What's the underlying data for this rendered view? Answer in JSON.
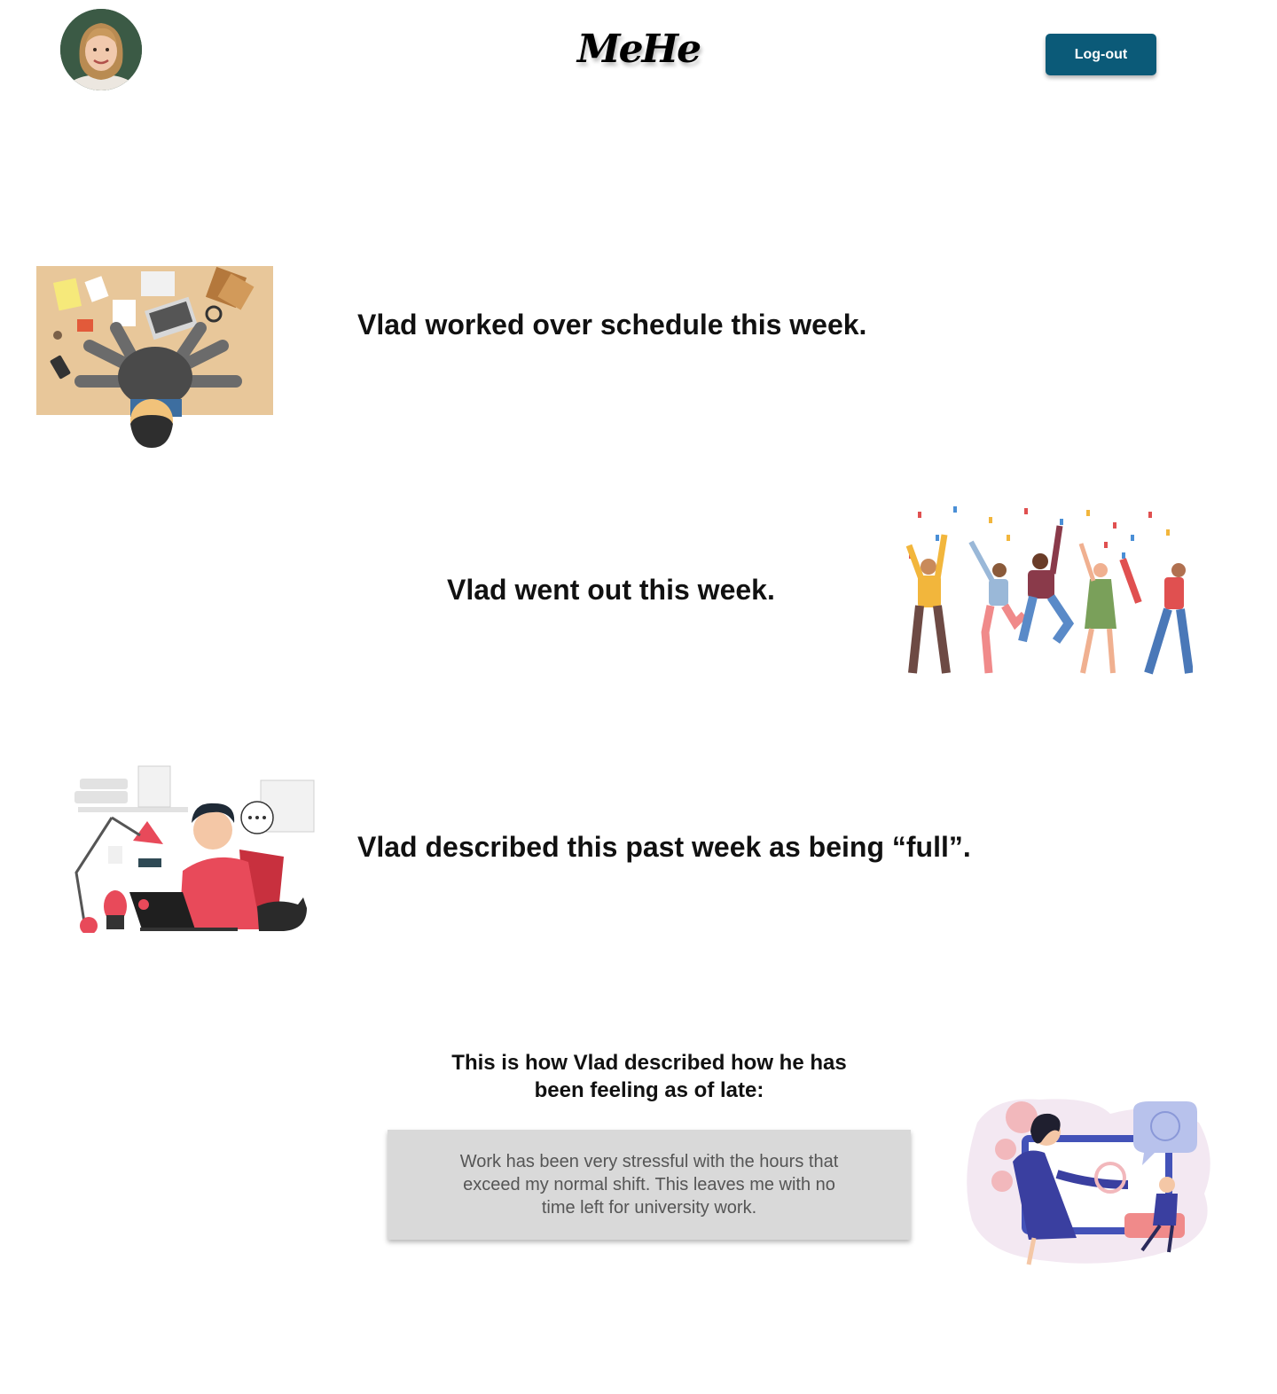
{
  "header": {
    "avatar_label": "",
    "logo": "MeHe",
    "logout_label": "Log-out"
  },
  "statements": [
    {
      "text": "Vlad worked over schedule this week.",
      "illustration": "multitasking-worker-illustration"
    },
    {
      "text": "Vlad went out this week.",
      "illustration": "party-friends-illustration"
    },
    {
      "text": "Vlad described this past week as being “full”.",
      "illustration": "man-at-laptop-illustration"
    }
  ],
  "feeling": {
    "heading": "This is how Vlad described how he has been feeling as of late:",
    "quote": "Work has been very stressful with the hours that exceed my normal shift. This leaves me with no time left for university work.",
    "illustration": "online-therapy-illustration"
  },
  "colors": {
    "accent": "#0b5a78",
    "quote_bg": "#d9d9d9",
    "text": "#111111"
  }
}
